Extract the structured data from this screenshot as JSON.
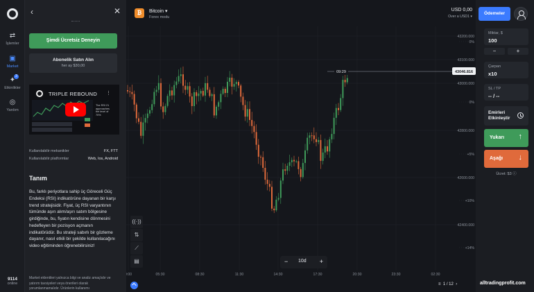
{
  "rail": {
    "items": [
      {
        "label": "İşlemler",
        "icon": "clock-arrows-icon"
      },
      {
        "label": "Market",
        "icon": "store-icon"
      },
      {
        "label": "Etkinlikler",
        "icon": "sparkle-icon",
        "badge": "3"
      },
      {
        "label": "Yardım",
        "icon": "help-icon"
      }
    ],
    "online_count": "9114",
    "online_label": "online"
  },
  "panel": {
    "try_button": "Şimdi Ücretsiz Deneyin",
    "subscribe_title": "Abonelik Satın Alın",
    "subscribe_price": "her ay $30,00",
    "video": {
      "title": "TRIPLE REBOUND",
      "side_text": "The RSI 21 approaches the level of 70%"
    },
    "features": [
      {
        "label": "Kullanılabilir mekanikler",
        "value": "FX, FTT"
      },
      {
        "label": "Kullanılabilir platformlar",
        "value": "Web, Ios, Android"
      }
    ],
    "section_title": "Tanım",
    "description": "Bu, farklı periyotlara sahip üç Göreceli Güç Endeksi (RSI) indikatörüne dayanan bir karşı trend stratejisidir. Fiyat, üç RSI varyantının tümünde aşırı alım/aşırı satım bölgesine girdiğinde, bu, fiyatın kendisine dönmesini hedefleyen bir pozisyon açmanın indikatörüdür. Bu strateji sabırlı bir gözleme dayanır, nasıl etkili bir şekilde kullanılacağını video eğitiminden öğrenebilirsiniz!",
    "note": "Market eklentileri yalnızca bilgi ve analiz amaçlıdır ve yatırım tavsiyeleri veya önerileri olarak yorumlanmamalıdır. Ürünlerin kullanımı"
  },
  "chart": {
    "asset_name": "Bitcoin",
    "asset_mode": "Forex modu",
    "asset_icon": "bitcoin-icon",
    "balance": "USD 0,00",
    "balance_sub": "Over a USD1",
    "timeframe": "10d",
    "page_indicator": "1 / 12",
    "current_time": "09:29",
    "current_price": "43046.816",
    "price_ticks": [
      "43200.000",
      "43100.000",
      "43000.000",
      "42800.000",
      "42600.000",
      "42400.000"
    ],
    "pct_ticks": [
      "0%",
      "0%",
      "+5%",
      "+10%",
      "+14%"
    ],
    "time_ticks": [
      "0:00",
      "05:30",
      "08:30",
      "11:30",
      "14:30",
      "17:30",
      "20:30",
      "23:30",
      "02:30"
    ],
    "up_color": "#3f9b5a",
    "down_color": "#e06a3b"
  },
  "right": {
    "payments_button": "Ödemeler",
    "amount_label": "Miktar, $",
    "amount_value": "100",
    "minus": "−",
    "plus": "+",
    "multiplier_label": "Çarpan",
    "multiplier_value": "x10",
    "sltp_label": "SL / TP",
    "sltp_value": "-- / --",
    "exec_label": "Emirleri Etkinleştir",
    "up_label": "Yukarı",
    "down_label": "Aşağı",
    "fee": "Ücret: $3",
    "up_color": "#3f9b5a",
    "down_color": "#e06a3b"
  },
  "watermark": "alltradingprofit.com"
}
